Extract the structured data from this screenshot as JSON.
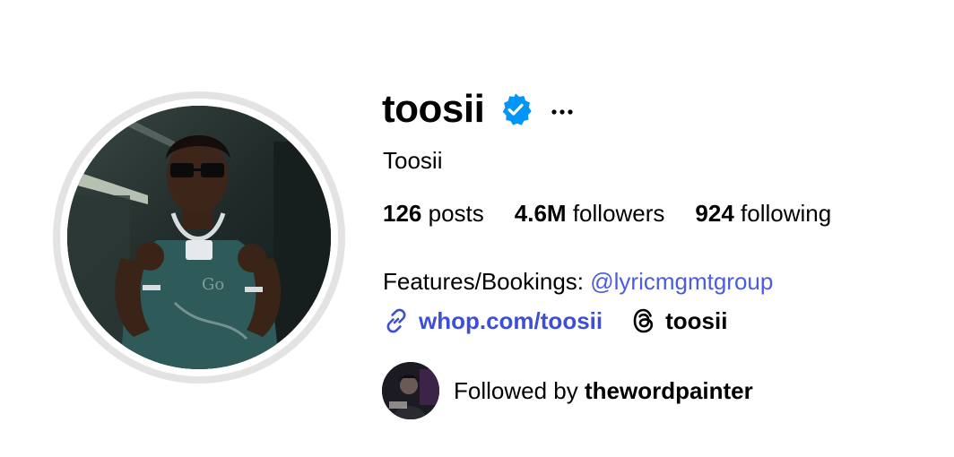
{
  "profile": {
    "username": "toosii",
    "display_name": "Toosii",
    "verified": true,
    "verified_icon": "verified-badge-icon",
    "more_icon": "ellipsis-icon",
    "accent_color": "#0095f6"
  },
  "stats": {
    "posts_count": "126",
    "posts_label": "posts",
    "followers_count": "4.6M",
    "followers_label": "followers",
    "following_count": "924",
    "following_label": "following"
  },
  "bio": {
    "prefix": "Features/Bookings: ",
    "mention": "@lyricmgmtgroup",
    "mention_color": "#4c5ce0"
  },
  "links": {
    "website_icon": "link-icon",
    "website": "whop.com/toosii",
    "threads_icon": "threads-icon",
    "threads_handle": "toosii"
  },
  "followed_by": {
    "prefix": "Followed by ",
    "user": "thewordpainter"
  }
}
